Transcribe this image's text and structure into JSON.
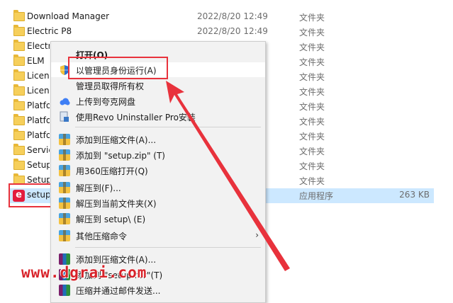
{
  "files": [
    {
      "name": "Download Manager",
      "date": "2022/8/20 12:49",
      "type": "文件夹",
      "size": ""
    },
    {
      "name": "Electric P8",
      "date": "2022/8/20 12:49",
      "type": "文件夹",
      "size": ""
    },
    {
      "name": "Electric",
      "date": "",
      "type": "文件夹",
      "size": ""
    },
    {
      "name": "ELM",
      "date": "",
      "type": "文件夹",
      "size": ""
    },
    {
      "name": "License",
      "date": "",
      "type": "文件夹",
      "size": ""
    },
    {
      "name": "License",
      "date": "",
      "type": "文件夹",
      "size": ""
    },
    {
      "name": "Platform",
      "date": "",
      "type": "文件夹",
      "size": ""
    },
    {
      "name": "Platform",
      "date": "",
      "type": "文件夹",
      "size": ""
    },
    {
      "name": "Platform",
      "date": "",
      "type": "文件夹",
      "size": ""
    },
    {
      "name": "Service",
      "date": "",
      "type": "文件夹",
      "size": ""
    },
    {
      "name": "Setup",
      "date": "",
      "type": "文件夹",
      "size": ""
    },
    {
      "name": "Setup",
      "date": "",
      "type": "文件夹",
      "size": ""
    },
    {
      "name": "setup",
      "date": "",
      "type": "应用程序",
      "size": "263 KB"
    }
  ],
  "setup_icon_glyph": "e",
  "menu": {
    "open": "打开(O)",
    "run_as_admin": "以管理员身份运行(A)",
    "take_ownership": "管理员取得所有权",
    "upload_quark": "上传到夸克网盘",
    "revo": "使用Revo Uninstaller Pro安装",
    "add_archive": "添加到压缩文件(A)...",
    "add_setup_zip": "添加到 \"setup.zip\" (T)",
    "open_360": "用360压缩打开(Q)",
    "extract_to": "解压到(F)...",
    "extract_here": "解压到当前文件夹(X)",
    "extract_setup": "解压到 setup\\ (E)",
    "other_cmds": "其他压缩命令",
    "rar_add_archive": "添加到压缩文件(A)...",
    "rar_add_rar": "添加到 \"setup.rar\"(T)",
    "rar_email": "压缩并通过邮件发送..."
  },
  "submenu_arrow": "›",
  "watermark": "www.dgrai.com",
  "colors": {
    "accent_red": "#e8323c",
    "selection": "#cce8ff"
  }
}
